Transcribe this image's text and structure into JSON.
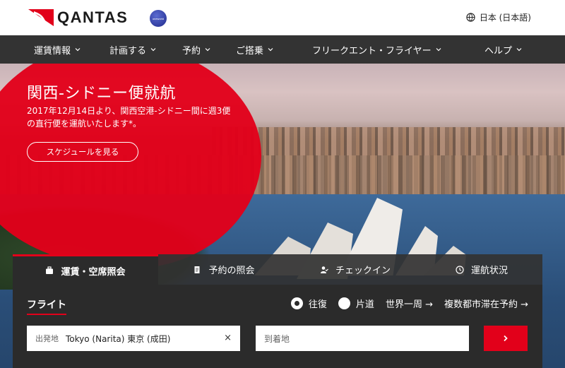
{
  "header": {
    "logo_text": "QANTAS",
    "oneworld_text": "oneworld",
    "language": "日本 (日本語)"
  },
  "nav": {
    "items": [
      {
        "label": "運賃情報"
      },
      {
        "label": "計画する"
      },
      {
        "label": "予約"
      },
      {
        "label": "ご搭乗"
      },
      {
        "label": "フリークエント・フライヤー"
      },
      {
        "label": "ヘルプ"
      }
    ]
  },
  "promo": {
    "title": "関西-シドニー便就航",
    "text": "2017年12月14日より、関西空港-シドニー間に週3便の直行便を運航いたします*。",
    "button": "スケジュールを見る"
  },
  "booking": {
    "tabs": [
      {
        "label": "運賃・空席照会"
      },
      {
        "label": "予約の照会"
      },
      {
        "label": "チェックイン"
      },
      {
        "label": "運航状況"
      }
    ],
    "flight_label": "フライト",
    "trip_types": {
      "round_trip": "往復",
      "one_way": "片道",
      "round_the_world": "世界一周 →",
      "multi_city": "複数都市滞在予約 →"
    },
    "from": {
      "label": "出発地",
      "value": "Tokyo (Narita) 東京 (成田)",
      "clear": "×"
    },
    "to": {
      "placeholder": "到着地"
    }
  },
  "colors": {
    "brand_red": "#e2001a",
    "nav_bg": "#333333",
    "panel_bg": "#2b2b2b"
  }
}
